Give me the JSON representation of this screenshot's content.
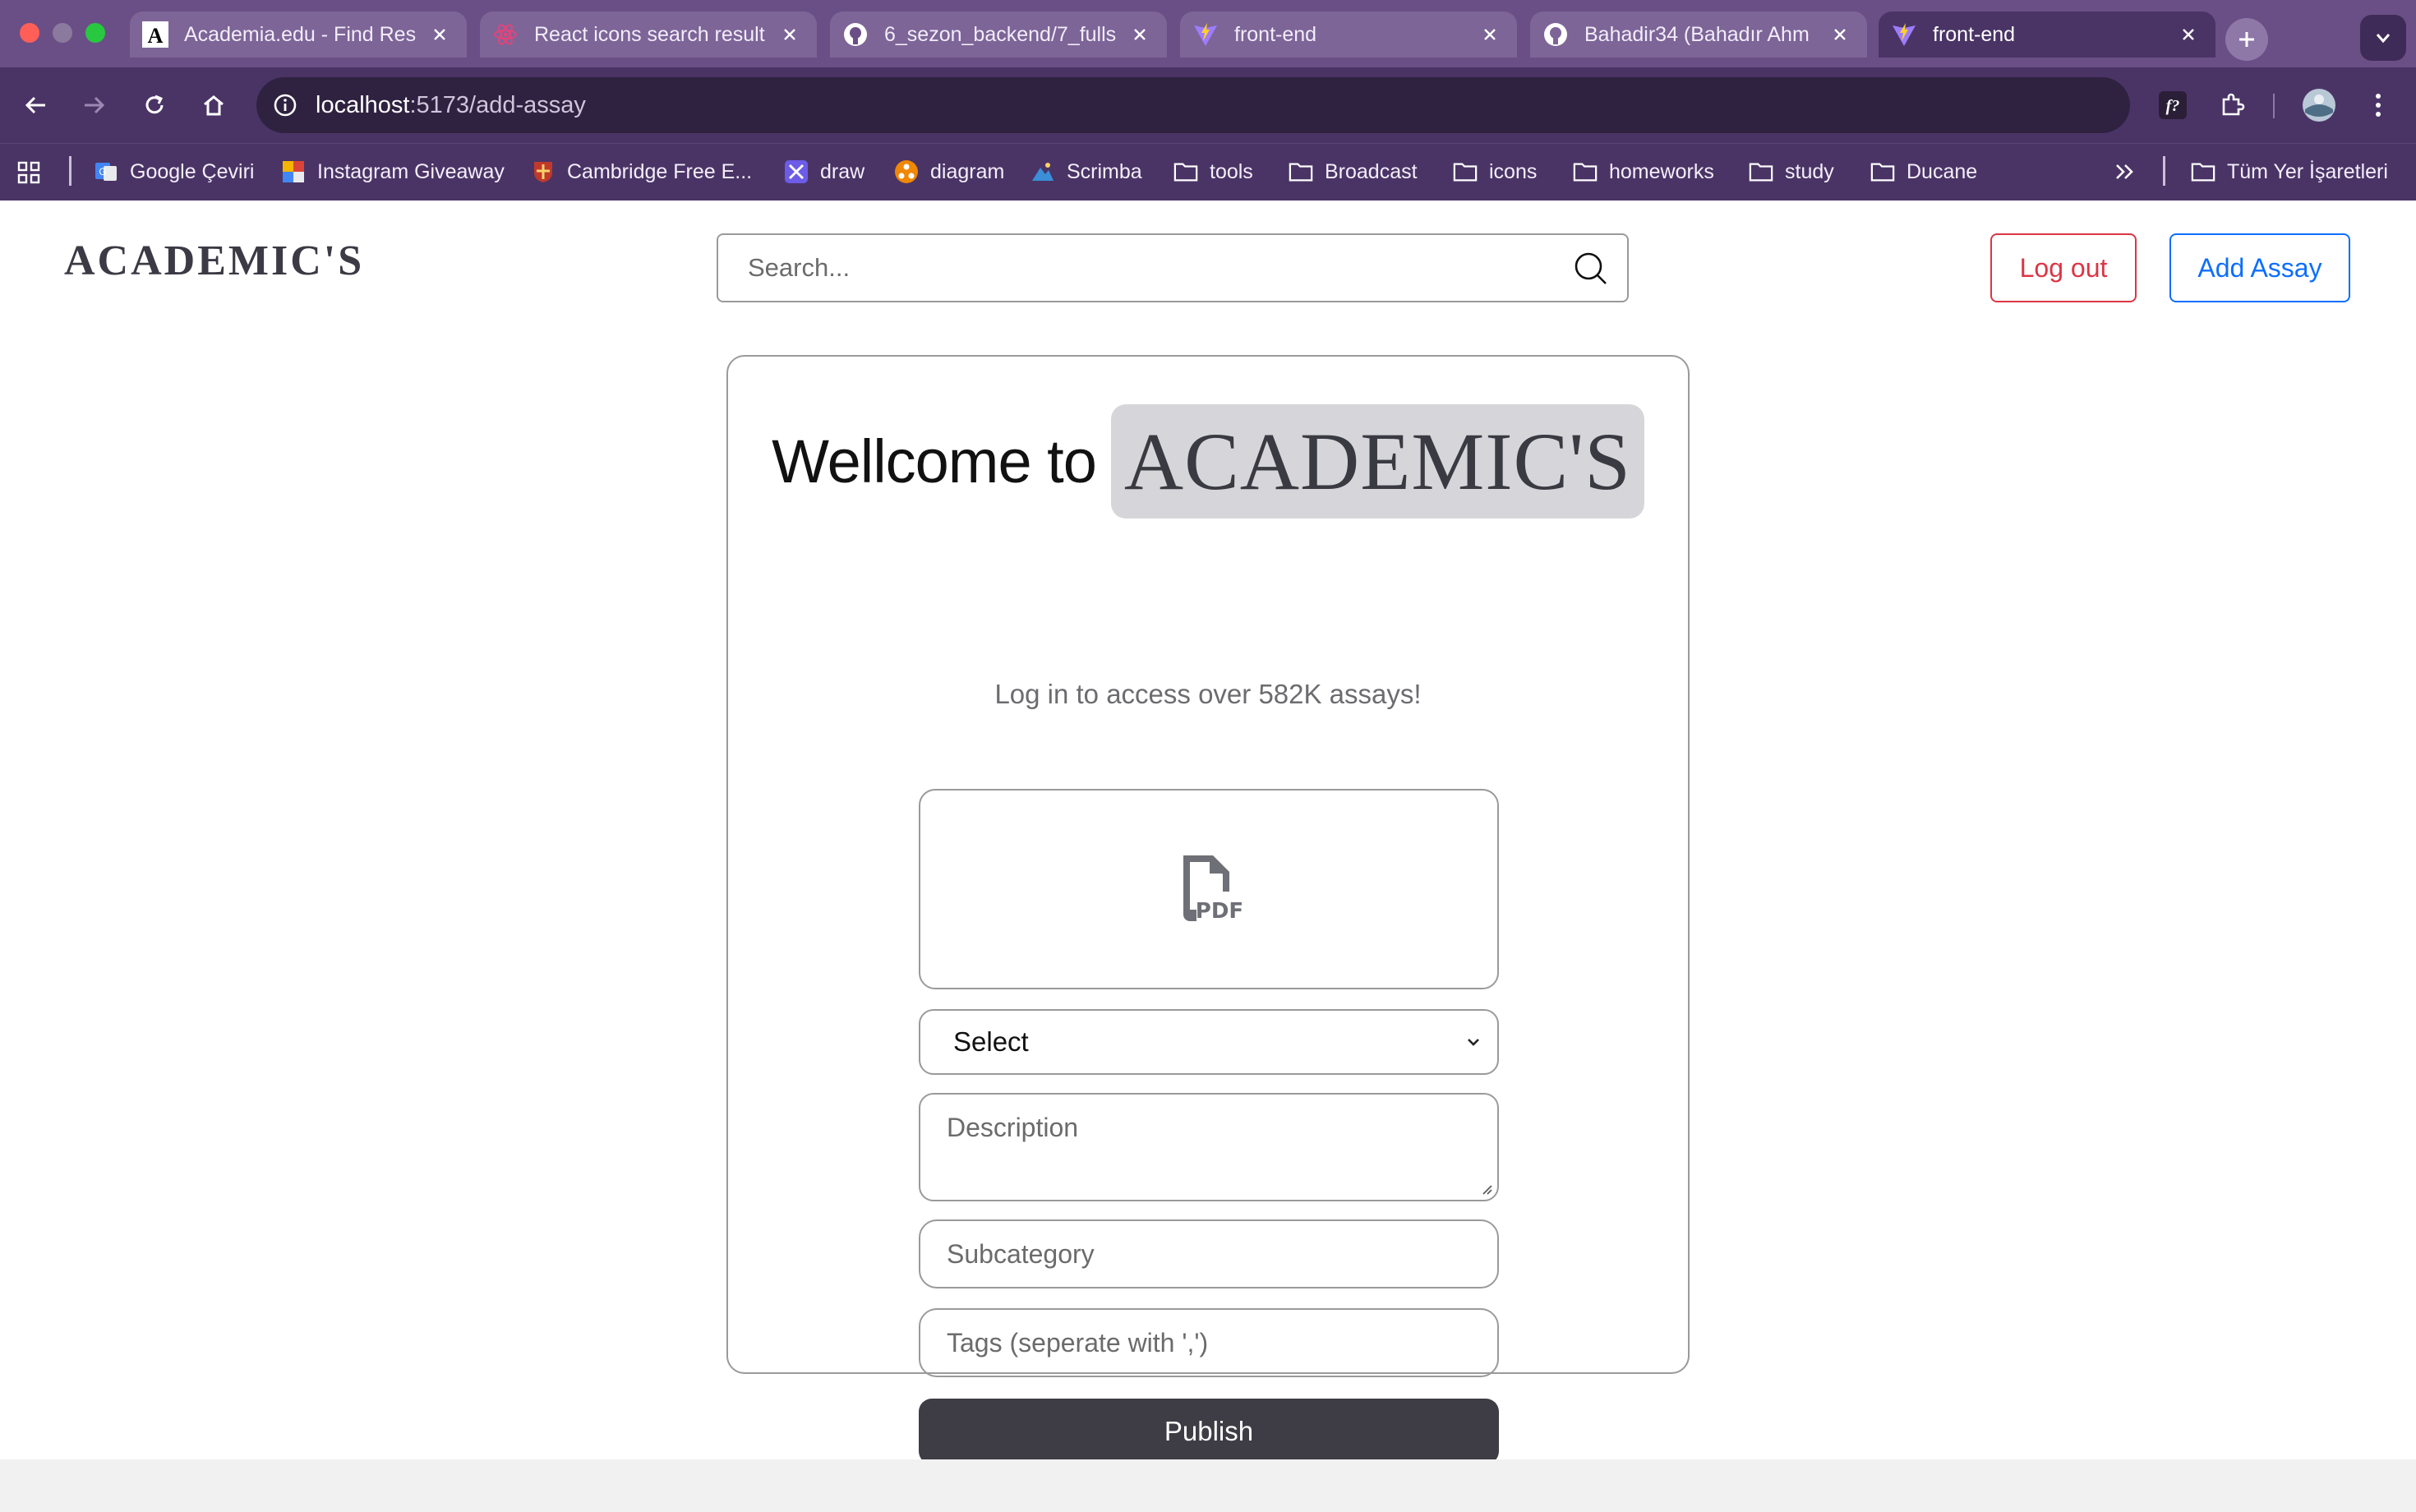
{
  "browser": {
    "tabs": [
      {
        "title": "Academia.edu - Find Res",
        "icon": "academia-icon",
        "active": false
      },
      {
        "title": "React icons search result",
        "icon": "react-icon",
        "active": false
      },
      {
        "title": "6_sezon_backend/7_fulls",
        "icon": "github-icon",
        "active": false
      },
      {
        "title": "front-end",
        "icon": "vite-icon",
        "active": false
      },
      {
        "title": "Bahadir34 (Bahadır Ahm",
        "icon": "github-icon",
        "active": false
      },
      {
        "title": "front-end",
        "icon": "vite-icon",
        "active": true
      }
    ],
    "url_host": "localhost",
    "url_path": ":5173/add-assay",
    "bookmarks": [
      {
        "label": "Google Çeviri",
        "icon": "google-translate-icon"
      },
      {
        "label": "Instagram Giveaway",
        "icon": "instagram-giveaway-icon"
      },
      {
        "label": "Cambridge Free E...",
        "icon": "cambridge-icon"
      },
      {
        "label": "draw",
        "icon": "draw-icon"
      },
      {
        "label": "diagram",
        "icon": "diagram-icon"
      },
      {
        "label": "Scrimba",
        "icon": "scrimba-icon"
      },
      {
        "label": "tools",
        "icon": "folder-icon"
      },
      {
        "label": "Broadcast",
        "icon": "folder-icon"
      },
      {
        "label": "icons",
        "icon": "folder-icon"
      },
      {
        "label": "homeworks",
        "icon": "folder-icon"
      },
      {
        "label": "study",
        "icon": "folder-icon"
      },
      {
        "label": "Ducane",
        "icon": "folder-icon"
      }
    ],
    "all_bookmarks": "Tüm Yer İşaretleri",
    "colors": {
      "tabbar": "#6a4f86",
      "toolbar": "#4a3466"
    }
  },
  "header": {
    "brand": "ACADEMIC'S",
    "search_placeholder": "Search...",
    "logout_label": "Log out",
    "add_label": "Add Assay",
    "colors": {
      "logout": "#dc3545",
      "add": "#0d6efd"
    }
  },
  "card": {
    "welcome_text": "Wellcome to",
    "welcome_brand": "ACADEMIC'S",
    "subtitle": "Log in to access over 582K assays!",
    "upload_icon": "pdf-file-icon",
    "select_value": "Select",
    "description_placeholder": "Description",
    "subcategory_placeholder": "Subcategory",
    "tags_placeholder": "Tags (seperate with ',')",
    "publish_label": "Publish",
    "publish_color": "#3e3d45"
  }
}
